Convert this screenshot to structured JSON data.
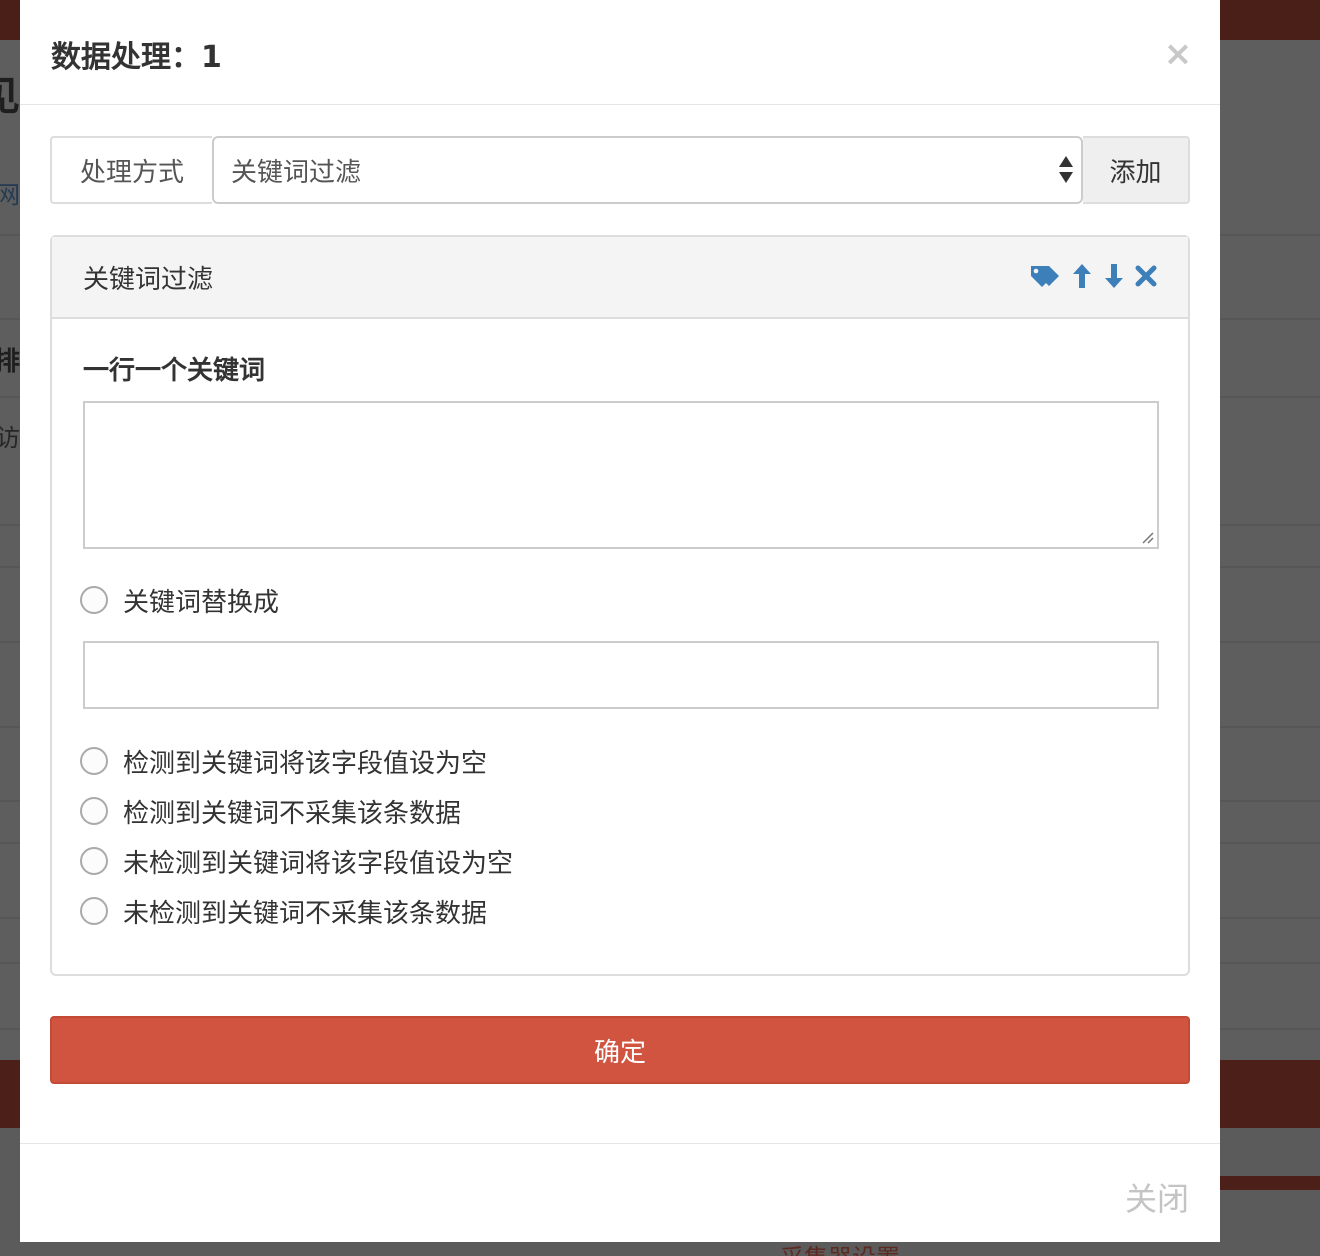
{
  "modal": {
    "title": "数据处理：1",
    "close_symbol": "×",
    "method_label": "处理方式",
    "method_selected": "关键词过滤",
    "add_label": "添加",
    "panel": {
      "title": "关键词过滤",
      "tools": [
        "tag-icon",
        "arrow-up-icon",
        "arrow-down-icon",
        "remove-icon"
      ],
      "keywords_label": "一行一个关键词",
      "keywords_value": "",
      "replace_option": "关键词替换成",
      "replace_value": "",
      "options": [
        "检测到关键词将该字段值设为空",
        "检测到关键词不采集该条数据",
        "未检测到关键词将该字段值设为空",
        "未检测到关键词不采集该条数据"
      ]
    },
    "confirm_label": "确定",
    "footer_close_label": "关闭"
  },
  "background": {
    "heading_fragment": "见",
    "link_fragment": "网",
    "bold_fragment": "数排",
    "plain_fragment": "试访",
    "bottom_text": "采集器设置"
  },
  "colors": {
    "accent_blue": "#3d7fb8",
    "confirm_red": "#d05440",
    "overlay_dark": "#5e5e5e",
    "page_red_dimmed": "#4c1f18"
  }
}
